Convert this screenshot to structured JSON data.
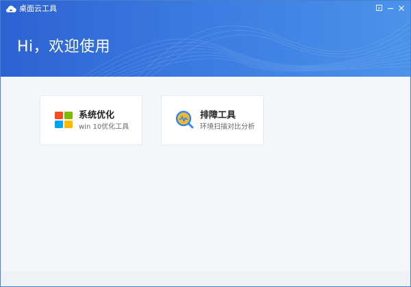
{
  "window": {
    "title": "桌面云工具",
    "app_icon": "cloud-icon",
    "controls": {
      "restore_icon": "restore-icon",
      "minimize_icon": "minimize-icon",
      "close_icon": "close-icon"
    }
  },
  "header": {
    "greeting": "Hi，欢迎使用"
  },
  "cards": [
    {
      "title": "系统优化",
      "subtitle": "win 10优化工具",
      "icon": "windows-logo-icon",
      "colors": [
        "#f25022",
        "#7fba00",
        "#00a4ef",
        "#ffb900"
      ]
    },
    {
      "title": "排障工具",
      "subtitle": "环境扫描对比分析",
      "icon": "magnifier-chart-icon",
      "colors": [
        "#2f86f6",
        "#f5b82e"
      ]
    }
  ],
  "colors": {
    "header_start": "#2d62d2",
    "header_end": "#4a93ea",
    "background": "#f3f6fa"
  }
}
